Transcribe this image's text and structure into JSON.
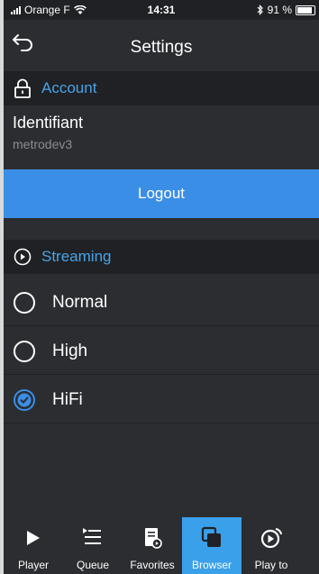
{
  "status_bar": {
    "carrier": "Orange F",
    "time": "14:31",
    "battery_percent": "91 %",
    "battery_level": 0.91
  },
  "nav": {
    "title": "Settings",
    "back_icon": "back-arrow-icon"
  },
  "account": {
    "header": "Account",
    "icon": "lock-icon",
    "id_label": "Identifiant",
    "id_value": "metrodev3",
    "logout_label": "Logout"
  },
  "streaming": {
    "header": "Streaming",
    "icon": "play-circle-icon",
    "options": [
      {
        "label": "Normal",
        "selected": false
      },
      {
        "label": "High",
        "selected": false
      },
      {
        "label": "HiFi",
        "selected": true
      }
    ]
  },
  "tabs": [
    {
      "label": "Player",
      "icon": "play-icon",
      "active": false
    },
    {
      "label": "Queue",
      "icon": "queue-list-icon",
      "active": false
    },
    {
      "label": "Favorites",
      "icon": "favorites-icon",
      "active": false
    },
    {
      "label": "Browser",
      "icon": "browser-icon",
      "active": true
    },
    {
      "label": "Play to",
      "icon": "play-to-icon",
      "active": false
    }
  ],
  "colors": {
    "accent": "#3a8ee6",
    "header_text": "#4aa3e8",
    "background": "#2b2d31",
    "section_bg": "#1f2124",
    "tab_active": "#3aa0ea"
  }
}
